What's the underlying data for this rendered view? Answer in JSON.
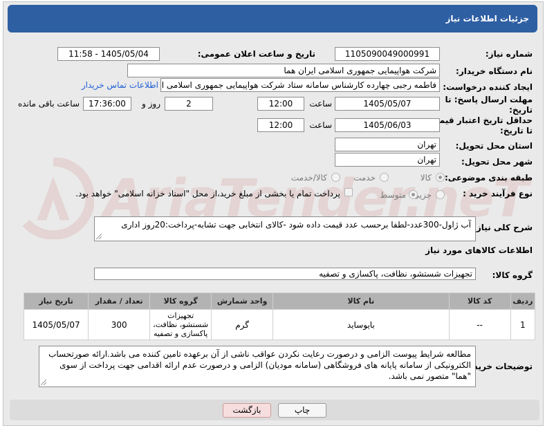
{
  "page": {
    "title": "جزئیات اطلاعات نیاز",
    "watermark": "AriaTender.neT"
  },
  "fields": {
    "need_number_label": "شماره نیاز:",
    "need_number": "1105090049000991",
    "announce_label": "تاریخ و ساعت اعلان عمومی:",
    "announce_value": "1405/05/04 - 11:58",
    "buyer_org_label": "نام دستگاه خریدار:",
    "buyer_org": "شرکت هواپیمایی جمهوری اسلامی ایران هما",
    "creator_label": "ایجاد کننده درخواست:",
    "creator": "فاطمه رجبی چهارده کارشناس سامانه ستاد شرکت هواپیمایی جمهوری اسلامی ایران هما",
    "contact_link": "اطلاعات تماس خریدار",
    "deadline_label_1": "مهلت ارسال پاسخ: تا",
    "deadline_label_2": "تاریخ:",
    "deadline_date": "1405/05/07",
    "time_word": "ساعت",
    "deadline_time": "12:00",
    "days_value": "2",
    "days_word": "روز و",
    "remaining_time": "17:36:00",
    "remaining_word": "ساعت باقی مانده",
    "min_valid_label_1": "حداقل تاریخ اعتبار قیمت:",
    "min_valid_label_2": "تا تاریخ:",
    "valid_date": "1405/06/03",
    "valid_time": "12:00",
    "province_label": "استان محل تحویل:",
    "province": "تهران",
    "city_label": "شهر محل تحویل:",
    "city": "تهران",
    "category_label": "طبقه بندی موضوعی:",
    "category_options": [
      "کالا",
      "خدمت",
      "کالا/خدمت"
    ],
    "process_label": "نوع فرآیند خرید :",
    "process_options": [
      "جزیی",
      "متوسط"
    ],
    "payment_note": "پرداخت تمام یا بخشی از مبلغ خرید،از محل \"اسناد خزانه اسلامی\" خواهد بود.",
    "description_label": "شرح کلی نیاز:",
    "description": "آب ژاول-300عدد-لطفا برحسب عدد قیمت داده شود -کالای انتخابی جهت تشابه-پرداخت:20روز اداری",
    "goods_info_title": "اطلاعات کالاهای مورد نیاز",
    "goods_group_label": "گروه کالا:",
    "goods_group": "تجهیزات شستشو، نظافت، پاکسازی و تصفیه",
    "buyer_notes_label": "توضیحات خریدار:",
    "buyer_notes": "مطالعه شرایط پیوست الزامی و درصورت رعایت نکردن عواقب ناشی از آن برعهده تامین کننده می باشد.ارائه صورتحساب الکترونیکی از سامانه پایانه های فروشگاهی (سامانه مودیان) الزامی و درصورت عدم ارائه اقدامی جهت پرداخت از سوی \"هما\" متصور نمی باشد."
  },
  "table": {
    "headers": [
      "ردیف",
      "کد کالا",
      "نام کالا",
      "واحد شمارش",
      "گروه کالا",
      "تعداد / مقدار",
      "تاریخ نیاز"
    ],
    "rows": [
      [
        "1",
        "--",
        "بایوساید",
        "گرم",
        "تجهیزات شستشو، نظافت، پاکسازی و تصفیه",
        "300",
        "1405/05/07"
      ]
    ]
  },
  "buttons": {
    "print": "چاپ",
    "back": "بازگشت"
  },
  "colors": {
    "header": "#2e5fa3",
    "link": "#1f5fd6",
    "table_header": "#b3b3b3",
    "back_button": "#f7dede"
  }
}
